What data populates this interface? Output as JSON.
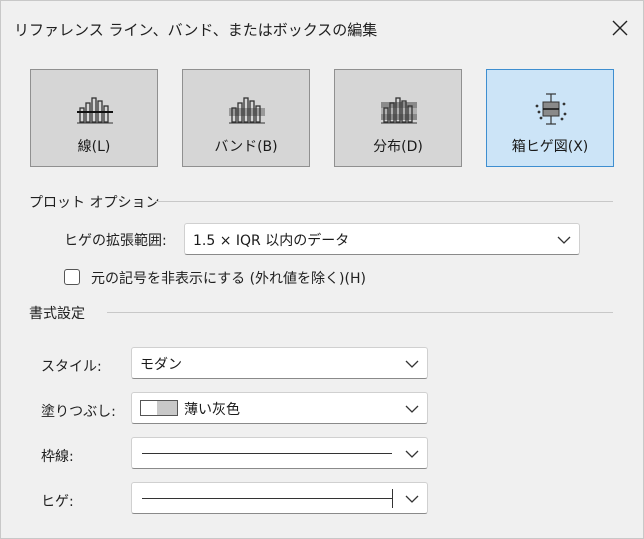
{
  "window": {
    "title": "リファレンス ライン、バンド、またはボックスの編集"
  },
  "mark_types": [
    {
      "label": "線(L)",
      "icon": "line-chart-icon",
      "selected": false
    },
    {
      "label": "バンド(B)",
      "icon": "band-chart-icon",
      "selected": false
    },
    {
      "label": "分布(D)",
      "icon": "distribution-chart-icon",
      "selected": false
    },
    {
      "label": "箱ヒゲ図(X)",
      "icon": "box-plot-icon",
      "selected": true
    }
  ],
  "plot_options": {
    "section_title": "プロット オプション",
    "whisker_label": "ヒゲの拡張範囲:",
    "whisker_value": "1.5 × IQR 以内のデータ",
    "hide_marks_label": "元の記号を非表示にする (外れ値を除く)(H)",
    "hide_marks_checked": false
  },
  "formatting": {
    "section_title": "書式設定",
    "style_label": "スタイル:",
    "style_value": "モダン",
    "fill_label": "塗りつぶし:",
    "fill_value": "薄い灰色",
    "border_label": "枠線:",
    "whisker_label": "ヒゲ:"
  },
  "colors": {
    "selected_bg": "#cce4f7",
    "selected_border": "#3e8ed0",
    "button_bg": "#d6d6d6"
  }
}
